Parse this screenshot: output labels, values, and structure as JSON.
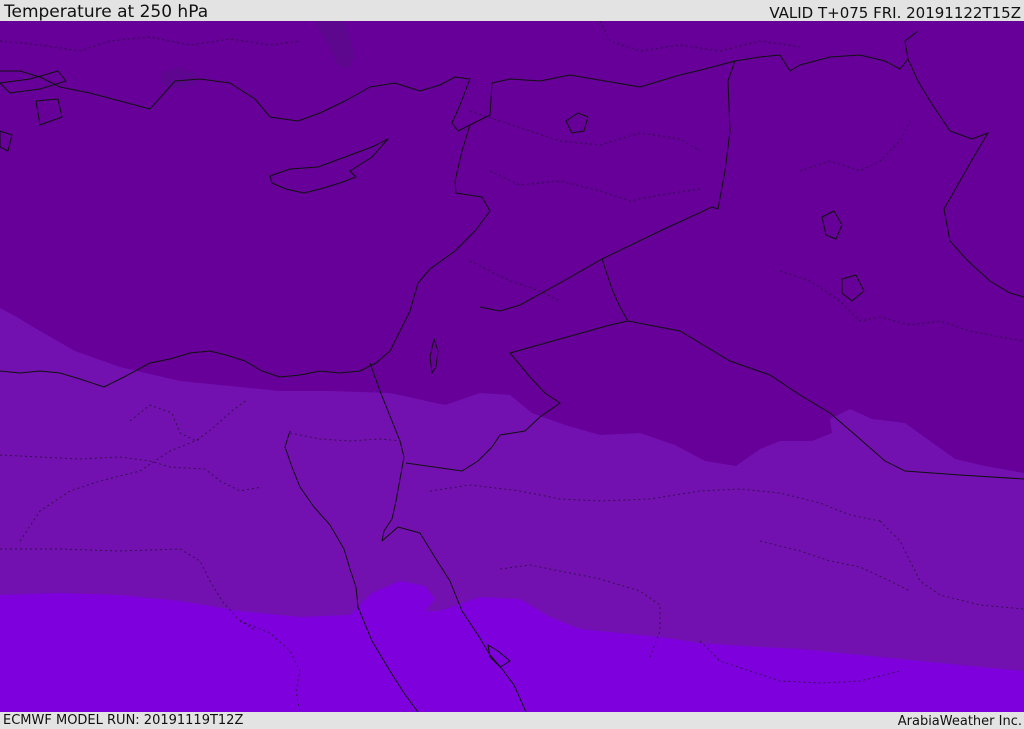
{
  "header": {
    "title": "Temperature at 250 hPa",
    "valid": "VALID T+075 FRI. 20191122T15Z"
  },
  "footer": {
    "model_run": "ECMWF MODEL RUN: 20191119T12Z",
    "credit": "ArabiaWeather Inc."
  },
  "map": {
    "field": "Temperature at 250 hPa",
    "colors": {
      "coldest_band": "#660099",
      "middle_band": "#7311b0",
      "warmest_band": "#7d00dd",
      "cold_pocket": "#5a0a8a",
      "coastline": "#111111",
      "admin_borders": "#2a1040"
    },
    "icons": [
      "coastline-layer",
      "country-borders-layer",
      "admin-boundaries-layer"
    ]
  }
}
